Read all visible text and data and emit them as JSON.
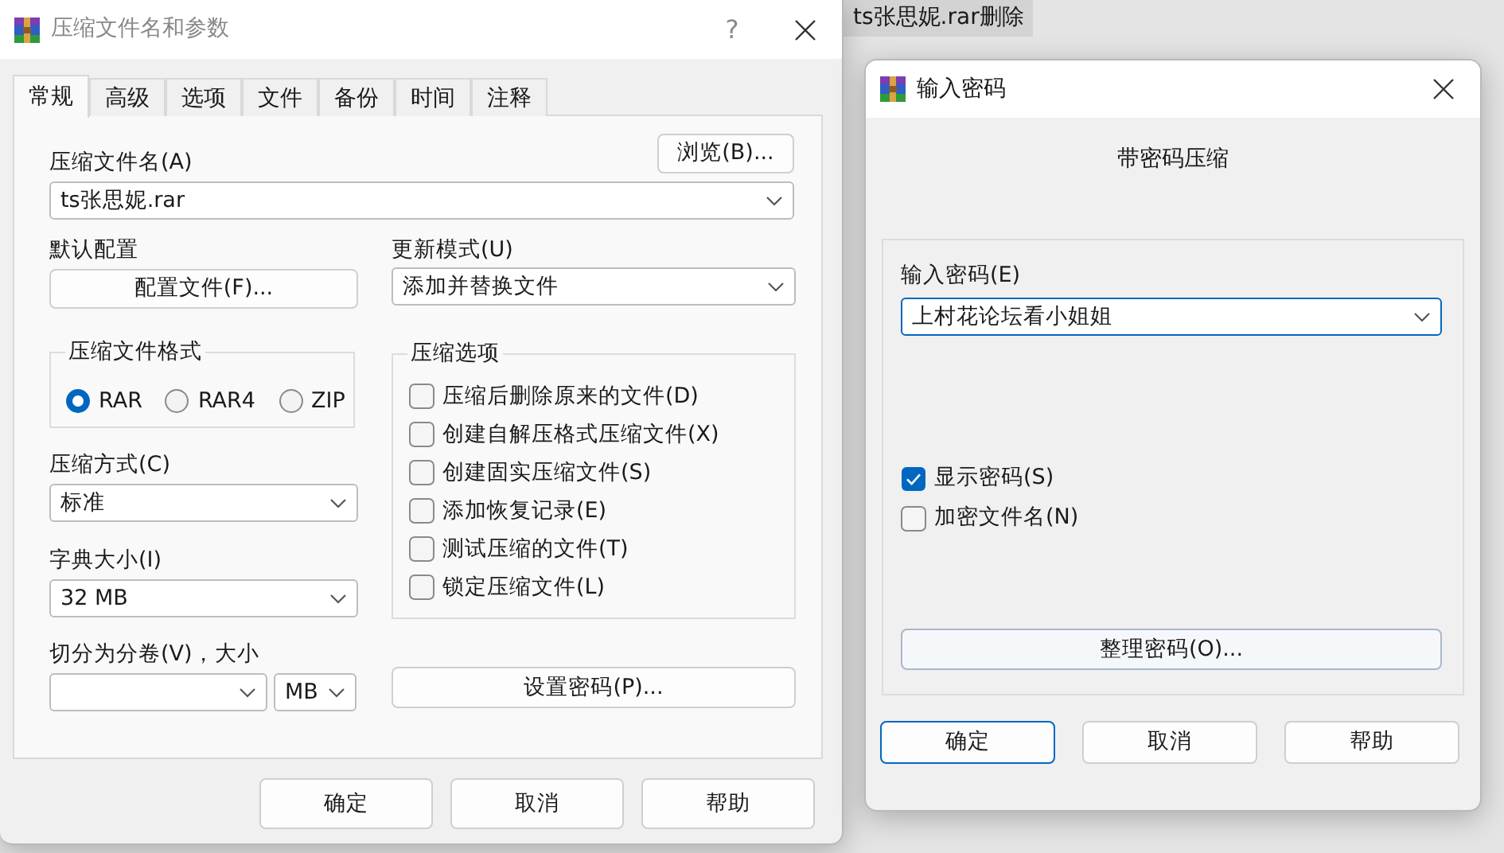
{
  "background_label": "ts张思妮.rar删除",
  "archive_dialog": {
    "title": "压缩文件名和参数",
    "help_button": "?",
    "tabs": [
      {
        "label": "常规",
        "selected": true
      },
      {
        "label": "高级",
        "selected": false
      },
      {
        "label": "选项",
        "selected": false
      },
      {
        "label": "文件",
        "selected": false
      },
      {
        "label": "备份",
        "selected": false
      },
      {
        "label": "时间",
        "selected": false
      },
      {
        "label": "注释",
        "selected": false
      }
    ],
    "archive_name": {
      "label": "压缩文件名(A)",
      "value": "ts张思妮.rar"
    },
    "browse_button": "浏览(B)...",
    "default_profile": {
      "label": "默认配置",
      "button": "配置文件(F)..."
    },
    "update_mode": {
      "label": "更新模式(U)",
      "value": "添加并替换文件"
    },
    "format_group": {
      "title": "压缩文件格式",
      "options": [
        {
          "label": "RAR",
          "selected": true
        },
        {
          "label": "RAR4",
          "selected": false
        },
        {
          "label": "ZIP",
          "selected": false
        }
      ]
    },
    "method": {
      "label": "压缩方式(C)",
      "value": "标准"
    },
    "dictionary": {
      "label": "字典大小(I)",
      "value": "32 MB"
    },
    "split": {
      "label": "切分为分卷(V)，大小",
      "unit": "MB"
    },
    "options_group": {
      "title": "压缩选项",
      "options": [
        {
          "label": "压缩后删除原来的文件(D)",
          "checked": false
        },
        {
          "label": "创建自解压格式压缩文件(X)",
          "checked": false
        },
        {
          "label": "创建固实压缩文件(S)",
          "checked": false
        },
        {
          "label": "添加恢复记录(E)",
          "checked": false
        },
        {
          "label": "测试压缩的文件(T)",
          "checked": false
        },
        {
          "label": "锁定压缩文件(L)",
          "checked": false
        }
      ]
    },
    "set_password_button": "设置密码(P)...",
    "buttons": [
      "确定",
      "取消",
      "帮助"
    ]
  },
  "password_dialog": {
    "title": "输入密码",
    "heading": "带密码压缩",
    "password": {
      "label": "输入密码(E)",
      "value": "上村花论坛看小姐姐",
      "focused": true
    },
    "options": [
      {
        "label": "显示密码(S)",
        "checked": true
      },
      {
        "label": "加密文件名(N)",
        "checked": false
      }
    ],
    "organize_button": "整理密码(O)...",
    "buttons": [
      {
        "label": "确定",
        "default": true
      },
      {
        "label": "取消",
        "default": false
      },
      {
        "label": "帮助",
        "default": false
      }
    ]
  }
}
